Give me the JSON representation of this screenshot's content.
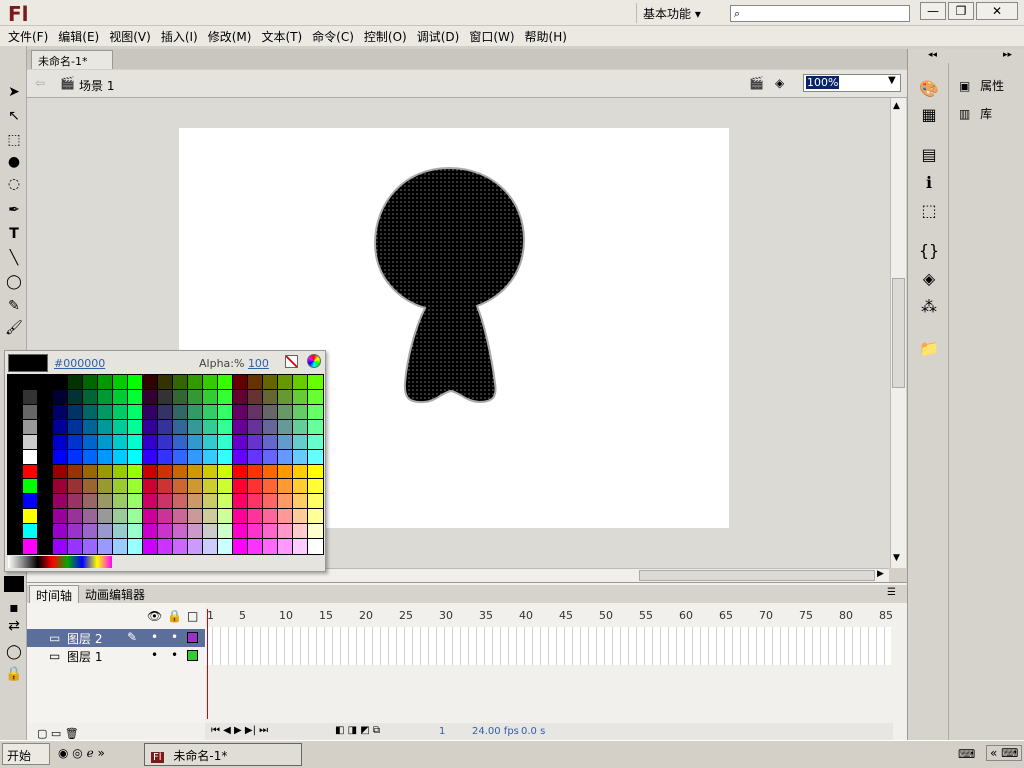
{
  "app": {
    "logo": "Fl",
    "workspace": "基本功能 ▾",
    "search_placeholder": ""
  },
  "window_buttons": {
    "minimize": "—",
    "restore": "❐",
    "close": "✕"
  },
  "menu": [
    "文件(F)",
    "编辑(E)",
    "视图(V)",
    "插入(I)",
    "修改(M)",
    "文本(T)",
    "命令(C)",
    "控制(O)",
    "调试(D)",
    "窗口(W)",
    "帮助(H)"
  ],
  "document": {
    "tab_title": "未命名-1*",
    "scene": "场景 1",
    "zoom": "100%"
  },
  "color_picker": {
    "hex": "#000000",
    "alpha_label": "Alpha:%",
    "alpha_value": "100",
    "current_color": "#000000"
  },
  "right_panel": {
    "items": [
      {
        "label": "属性",
        "icon": "properties-icon"
      },
      {
        "label": "库",
        "icon": "library-icon"
      }
    ]
  },
  "timeline": {
    "tabs": [
      "时间轴",
      "动画编辑器"
    ],
    "ruler": [
      "1",
      "5",
      "10",
      "15",
      "20",
      "25",
      "30",
      "35",
      "40",
      "45",
      "50",
      "55",
      "60",
      "65",
      "70",
      "75",
      "80",
      "85"
    ],
    "layers": [
      {
        "name": "图层 2",
        "color": "#9b30c8",
        "selected": true
      },
      {
        "name": "图层 1",
        "color": "#33cc33",
        "selected": false
      }
    ],
    "status": {
      "frame": "1",
      "fps": "24.00 fps",
      "time": "0.0 s"
    }
  },
  "taskbar": {
    "start": "开始",
    "task": "未命名-1*"
  },
  "colors": {
    "accent": "#0a246a",
    "stage": "#ffffff"
  }
}
